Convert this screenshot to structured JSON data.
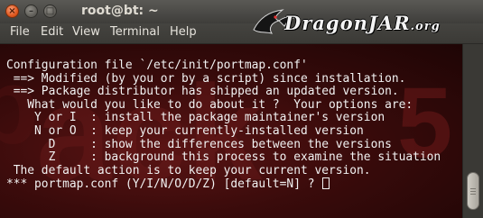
{
  "window": {
    "title": "root@bt: ~",
    "close_glyph": "×",
    "min_glyph": "–",
    "max_glyph": "□"
  },
  "menubar": {
    "items": [
      "File",
      "Edit",
      "View",
      "Terminal",
      "Help"
    ]
  },
  "watermark": {
    "text": "DragonJAR",
    "suffix": ".org"
  },
  "terminal": {
    "lines": [
      "Configuration file `/etc/init/portmap.conf'",
      " ==> Modified (by you or by a script) since installation.",
      " ==> Package distributor has shipped an updated version.",
      "   What would you like to do about it ?  Your options are:",
      "    Y or I  : install the package maintainer's version",
      "    N or O  : keep your currently-installed version",
      "      D     : show the differences between the versions",
      "      Z     : background this process to examine the situation",
      " The default action is to keep your current version.",
      "*** portmap.conf (Y/I/N/O/D/Z) [default=N] ? "
    ],
    "colors": {
      "fg": "#f2f2f2",
      "bg": "#3a0b0b"
    }
  },
  "icons": {
    "close": "close-icon",
    "minimize": "minimize-icon",
    "maximize": "maximize-icon",
    "dragon": "dragon-logo-icon"
  }
}
